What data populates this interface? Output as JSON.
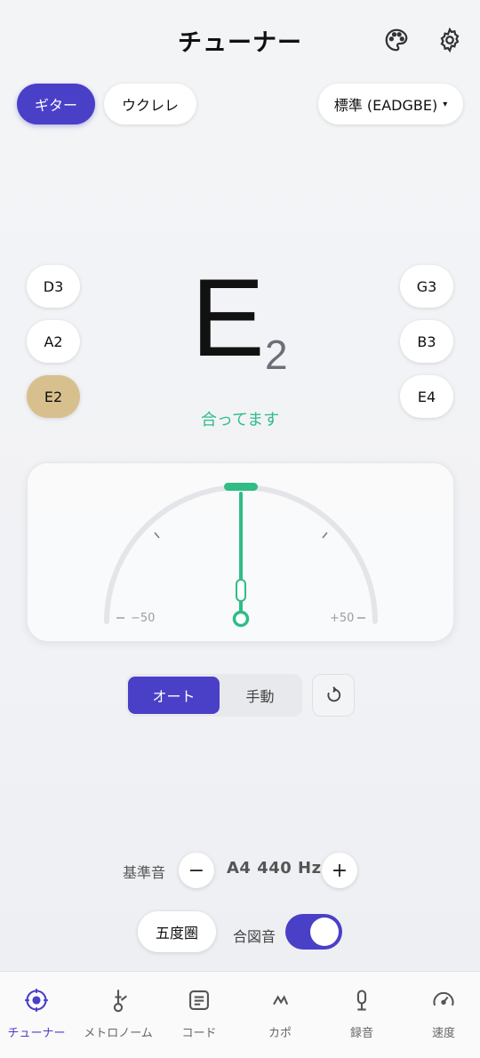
{
  "header": {
    "title": "チューナー",
    "palette_icon": "palette-icon",
    "settings_icon": "gear-icon"
  },
  "instruments": [
    {
      "label": "ギター",
      "active": true
    },
    {
      "label": "ウクレレ",
      "active": false
    }
  ],
  "tuning": {
    "label": "標準 (EADGBE)",
    "caret": "▾"
  },
  "strings_left": [
    {
      "label": "D3",
      "active": false
    },
    {
      "label": "A2",
      "active": false
    },
    {
      "label": "E2",
      "active": true
    }
  ],
  "strings_right": [
    {
      "label": "G3",
      "active": false
    },
    {
      "label": "B3",
      "active": false
    },
    {
      "label": "E4",
      "active": false
    }
  ],
  "note": {
    "letter": "E",
    "octave": "2",
    "status": "合ってます"
  },
  "meter": {
    "min_label": "−50",
    "max_label": "+50",
    "cents": 0,
    "needle_value": "0"
  },
  "mode": {
    "auto_label": "オート",
    "manual_label": "手動",
    "selected": "auto"
  },
  "reference": {
    "label": "基準音",
    "value": "A4 440 Hz",
    "minus": "−",
    "plus": "+"
  },
  "circle_of_fifths": {
    "label": "五度圏"
  },
  "beep": {
    "label": "合図音",
    "on": true
  },
  "nav": [
    {
      "label": "チューナー",
      "icon": "tuner-icon",
      "active": true
    },
    {
      "label": "メトロノーム",
      "icon": "metronome-icon",
      "active": false
    },
    {
      "label": "コード",
      "icon": "chord-icon",
      "active": false
    },
    {
      "label": "カポ",
      "icon": "capo-icon",
      "active": false
    },
    {
      "label": "録音",
      "icon": "microphone-icon",
      "active": false
    },
    {
      "label": "速度",
      "icon": "speedometer-icon",
      "active": false
    }
  ],
  "colors": {
    "accent": "#4a3fc7",
    "in_tune": "#2fbd85",
    "selected_string": "#d7c08e"
  }
}
